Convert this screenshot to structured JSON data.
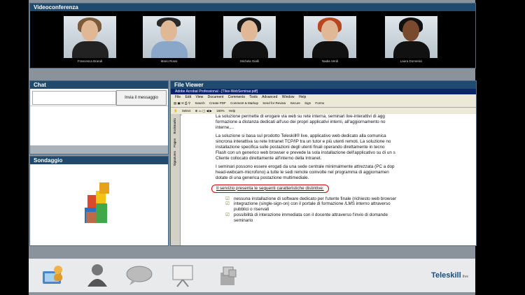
{
  "video": {
    "title": "Videoconferenza",
    "participants": [
      {
        "name": "Francesca Brandi"
      },
      {
        "name": "Mario Rossi"
      },
      {
        "name": "Michela Gialli"
      },
      {
        "name": "Nadia Verdi"
      },
      {
        "name": "Laura Domenici"
      }
    ]
  },
  "chat": {
    "title": "Chat",
    "send_label": "Invia il messaggio"
  },
  "poll": {
    "title": "Sondaggio"
  },
  "file_viewer": {
    "title": "File Viewer",
    "window_title": "Adobe Acrobat Professional - [Tlive-WebSeminar.pdf]",
    "menu": [
      "File",
      "Edit",
      "View",
      "Document",
      "Comments",
      "Tools",
      "Advanced",
      "Window",
      "Help"
    ],
    "toolbar1": [
      "Search",
      "Create PDF",
      "Comment & Markup",
      "Send for Review",
      "Secure",
      "Sign",
      "Forms"
    ],
    "toolbar2": [
      "Select",
      "150%",
      "Help"
    ],
    "side_tabs": [
      "Bookmarks",
      "Pages",
      "Signatures"
    ],
    "paragraphs": [
      [
        "La soluzione permette di erogare via web su rete interna, seminari live-interattivi di agg",
        "formazione a distanza dedicati all'uso dei propri applicativi interni, all'aggiornamento no",
        "interne,..."
      ],
      [
        "La soluzione si basa sul prodotto Teleskill® live, applicativo web dedicato alla comunica",
        "sincrona interattiva su rete Intranet TCP/IP tra un tutor e più utenti remoti. La soluzione no",
        "installazione specifica sulle postazioni degli utenti finali operando direttamente in tecno",
        "Flash con un generico web browser e prevede la sola installazione dell'applicativo su di un s",
        "Cliente collocato direttamente all'interno della Intranet."
      ],
      [
        "I seminari possono essere erogati da una sede centrale minimalmente attrezzata (PC a dop",
        "head-webcam-microfono) a tutte le sedi remote coinvolte nel programma di aggiornamen",
        "dotate di una generica postazione multimediale."
      ]
    ],
    "highlight": "Il servizio presenta le seguenti caratteristiche distintive:",
    "bullets": [
      "nessuna installazione di software dedicato per l'utente finale (richiesto web browser",
      "integrazione (single-sign-on) con il portale di formazione /LMS interno attraverso",
      "pubblici o riservati",
      "possibilità di interazione immediata con il docente attraverso l'invio di domande",
      "seminario"
    ]
  },
  "brand": {
    "name": "Teleskill",
    "tag": "live"
  },
  "dock": [
    {
      "icon": "users-computer-icon"
    },
    {
      "icon": "presenter-icon"
    },
    {
      "icon": "chat-bubble-icon"
    },
    {
      "icon": "whiteboard-icon"
    },
    {
      "icon": "documents-icon"
    }
  ]
}
